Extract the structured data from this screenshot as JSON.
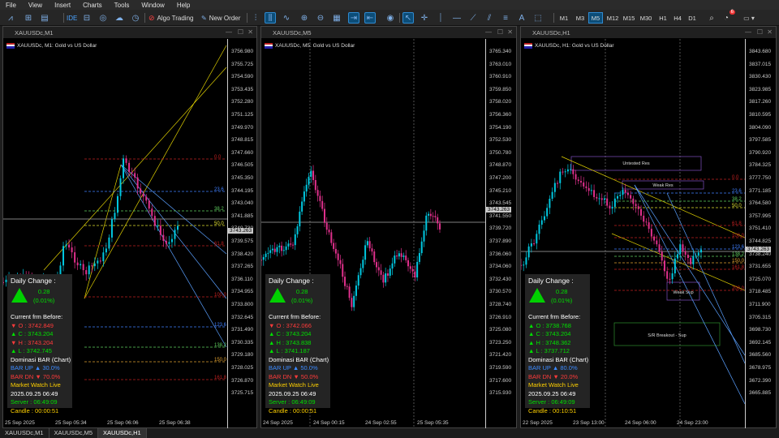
{
  "menu": [
    "File",
    "View",
    "Insert",
    "Charts",
    "Tools",
    "Window",
    "Help"
  ],
  "toolbar": {
    "ide": "IDE",
    "algo": "Algo Trading",
    "neworder": "New Order",
    "timeframes": [
      "M1",
      "M3",
      "M5",
      "M12",
      "M15",
      "M30",
      "H1",
      "H4",
      "D1"
    ],
    "selected_tf": "M5",
    "notif": "6"
  },
  "colors": {
    "bull": "#00c8e0",
    "bear": "#e0308c",
    "up": "#00e000",
    "down": "#ff3b3b",
    "accent": "#2f8ad0"
  },
  "charts": [
    {
      "title": "XAUUSDc,M1",
      "label": "XAUUSDc, M1:  Gold vs US Dollar",
      "current_price": "3743.263",
      "time_labels": [
        "25 Sep 2025",
        "25 Sep 05:34",
        "25 Sep 06:06",
        "25 Sep 06:38"
      ],
      "prices": [
        "3756.980",
        "3755.725",
        "3754.590",
        "3753.435",
        "3752.280",
        "3751.125",
        "3749.970",
        "3748.815",
        "3747.660",
        "3746.505",
        "3745.350",
        "3744.195",
        "3743.040",
        "3741.885",
        "3740.730",
        "3739.575",
        "3738.420",
        "3737.265",
        "3736.110",
        "3734.955",
        "3733.800",
        "3732.645",
        "3731.490",
        "3730.335",
        "3729.180",
        "3728.025",
        "3726.870",
        "3725.715"
      ],
      "fibo": [
        "0.0",
        "23.6",
        "38.2",
        "50.0",
        "61.8",
        "100.0",
        "123.6",
        "138.2",
        "150.0",
        "161.8"
      ],
      "ext_fibo": [
        "61.8",
        "50.0",
        "38.2"
      ],
      "info": {
        "title": "Daily Change :",
        "change": "0.28",
        "pct": "(0.01%)",
        "before": "Current frm Before:",
        "o": "▼ O : 3742.849",
        "c": "▲ C : 3743.204",
        "h": "▼ H : 3743.204",
        "l": "▲ L : 3742.745",
        "dom": "Dominasi BAR (Chart)",
        "up": "BAR UP ▲ 30.0%",
        "dn": "BAR DN ▼ 70.0%",
        "mw": "Market Watch Live",
        "date": "2025.09.25 06:49",
        "server": "Server  : 06:49:09",
        "candle": "Candle  : 00:00:51"
      }
    },
    {
      "title": "XAUUSDc,M5",
      "label": "XAUUSDc, M5:  Gold vs US Dollar",
      "current_price": "3743.263",
      "time_labels": [
        "24 Sep 2025",
        "24 Sep 00:15",
        "24 Sep 02:55",
        "25 Sep 05:35"
      ],
      "prices": [
        "3765.340",
        "3763.010",
        "3760.910",
        "3759.850",
        "3758.020",
        "3756.360",
        "3754.190",
        "3752.530",
        "3750.780",
        "3748.870",
        "3747.200",
        "3745.210",
        "3743.545",
        "3741.550",
        "3739.720",
        "3737.890",
        "3736.060",
        "3734.060",
        "3732.430",
        "3730.570",
        "3728.740",
        "3726.910",
        "3725.080",
        "3723.250",
        "3721.420",
        "3719.590",
        "3717.600",
        "3715.930"
      ],
      "info": {
        "title": "Daily Change :",
        "change": "0.28",
        "pct": "(0.01%)",
        "before": "Current frm Before:",
        "o": "▼ O : 3742.066",
        "c": "▲ C : 3743.204",
        "h": "▲ H : 3743.838",
        "l": "▲ L : 3741.187",
        "dom": "Dominasi BAR (Chart)",
        "up": "BAR UP ▲ 50.0%",
        "dn": "BAR DN ▼ 50.0%",
        "mw": "Market Watch Live",
        "date": "2025.09.25 06:49",
        "server": "Server  : 06:49:09",
        "candle": "Candle  : 00:00:51"
      }
    },
    {
      "title": "XAUUSDc,H1",
      "label": "XAUUSDc, H1:  Gold vs US Dollar",
      "current_price": "3743.263",
      "time_labels": [
        "22 Sep 2025",
        "23 Sep 13:00",
        "24 Sep 06:00",
        "24 Sep 23:00"
      ],
      "prices": [
        "3843.680",
        "3837.015",
        "3830.430",
        "3823.985",
        "3817.260",
        "3810.595",
        "3804.090",
        "3797.585",
        "3790.920",
        "3784.325",
        "3777.750",
        "3771.185",
        "3764.580",
        "3757.995",
        "3751.410",
        "3744.825",
        "3738.240",
        "3731.655",
        "3725.070",
        "3718.485",
        "3711.900",
        "3705.315",
        "3698.730",
        "3692.145",
        "3685.560",
        "3678.975",
        "3672.390",
        "3665.885"
      ],
      "zones": [
        "Untested Res",
        "Weak Res",
        "Weak Sup",
        "S/R Breakout - Sup"
      ],
      "fibo": [
        "0.0",
        "23.6",
        "38.2",
        "50.0",
        "61.8",
        "100.0",
        "123.6",
        "138.2",
        "150.0",
        "161.8",
        "200.0"
      ],
      "ext_fibo": [
        "61.8",
        "50.0"
      ],
      "info": {
        "title": "Daily Change :",
        "change": "0.28",
        "pct": "(0.01%)",
        "before": "Current frm Before:",
        "o": "▲ O : 3738.768",
        "c": "▲ C : 3743.204",
        "h": "▲ H : 3748.362",
        "l": "▲ L : 3737.712",
        "dom": "Dominasi BAR (Chart)",
        "up": "BAR UP ▲ 80.0%",
        "dn": "BAR DN ▼ 20.0%",
        "mw": "Market Watch Live",
        "date": "2025.09.25 06:49",
        "server": "Server  : 06:49:09",
        "candle": "Candle  : 00:10:51"
      }
    }
  ],
  "tabs": [
    "XAUUSDc,M1",
    "XAUUSDc,M5",
    "XAUUSDc,H1"
  ],
  "active_tab": "XAUUSDc,H1"
}
